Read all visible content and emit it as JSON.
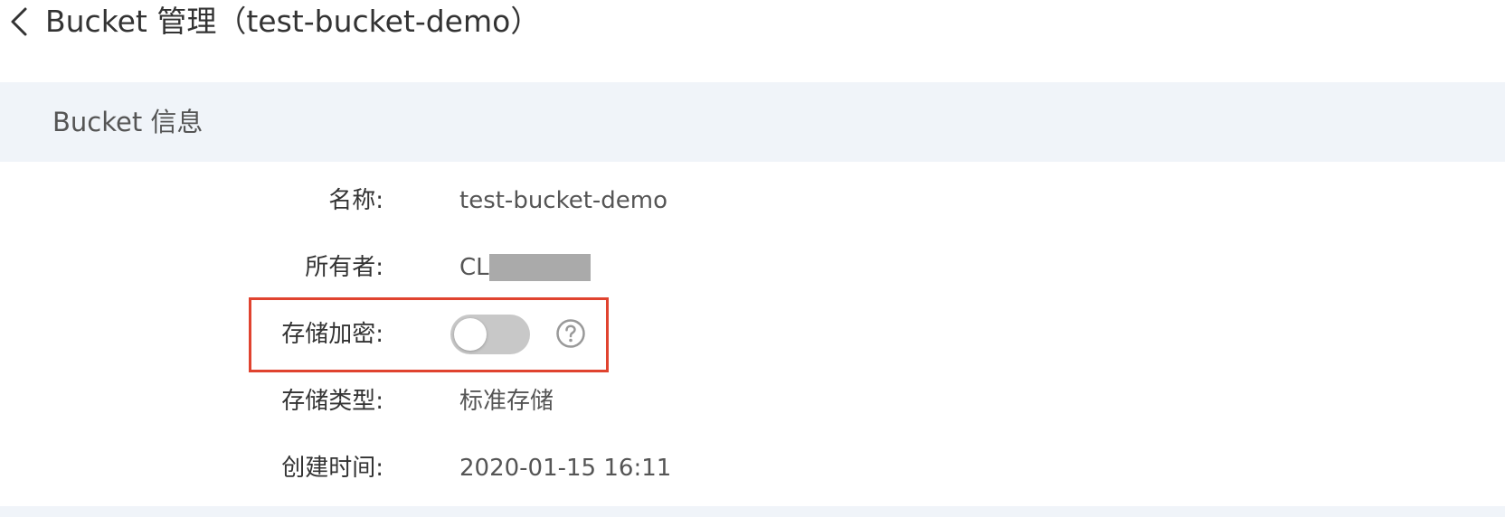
{
  "header": {
    "title": "Bucket 管理（test-bucket-demo）"
  },
  "section": {
    "title": "Bucket 信息"
  },
  "fields": {
    "name": {
      "label": "名称:",
      "value": "test-bucket-demo"
    },
    "owner": {
      "label": "所有者:",
      "value": "CL"
    },
    "encryption": {
      "label": "存储加密:",
      "enabled": false
    },
    "storage_type": {
      "label": "存储类型:",
      "value": "标准存储"
    },
    "created": {
      "label": "创建时间:",
      "value": "2020-01-15 16:11"
    }
  },
  "icons": {
    "back": "chevron-left-icon",
    "help": "question-circle-icon"
  },
  "colors": {
    "section_bg": "#f0f4f9",
    "highlight": "#e0432f",
    "toggle_off": "#c8c8c8"
  }
}
